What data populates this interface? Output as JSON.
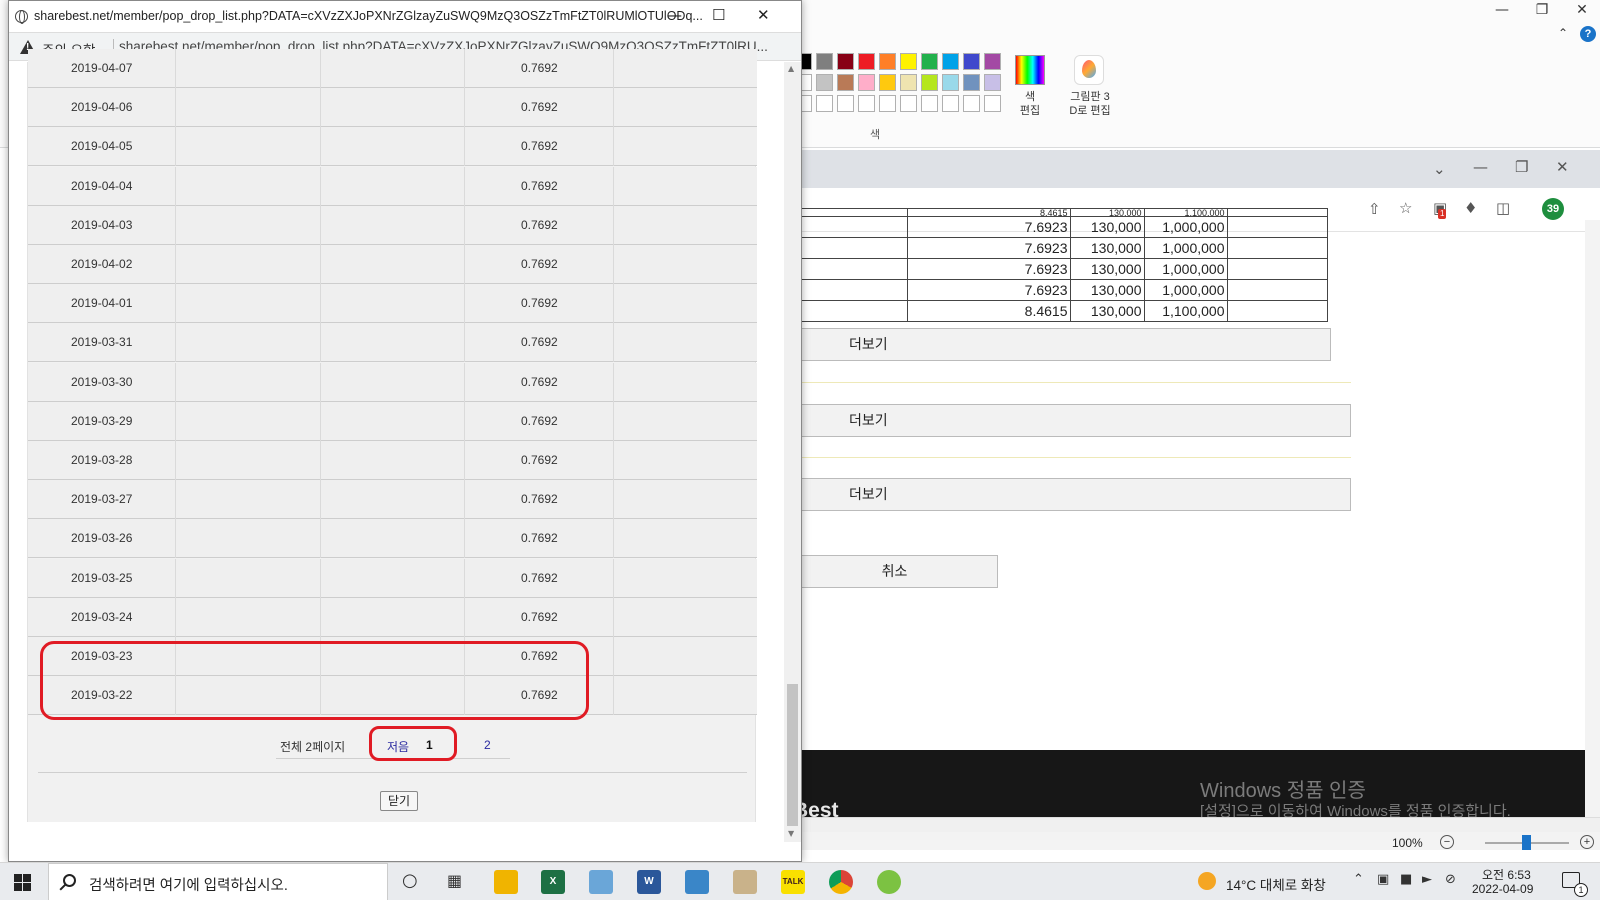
{
  "paint": {
    "palette_label": "색",
    "edit_colors_label": "색\n편집",
    "paint3d_label": "그림판 3\nD로 편집",
    "colors": [
      "#000000",
      "#7f7f7f",
      "#880015",
      "#ed1c24",
      "#ff7f27",
      "#fff200",
      "#22b14c",
      "#00a2e8",
      "#3f48cc",
      "#a349a4",
      "#ffffff",
      "#c3c3c3",
      "#b97a57",
      "#ffaec9",
      "#ffc90e",
      "#efe4b0",
      "#b5e61d",
      "#99d9ea",
      "#7092be",
      "#c8bfe7"
    ]
  },
  "browser": {
    "profile_count": "39",
    "extension_badge": "1",
    "table_rows": [
      [
        "8.4615",
        "130,000",
        "1,100,000"
      ],
      [
        "7.6923",
        "130,000",
        "1,000,000"
      ],
      [
        "7.6923",
        "130,000",
        "1,000,000"
      ],
      [
        "7.6923",
        "130,000",
        "1,000,000"
      ],
      [
        "7.6923",
        "130,000",
        "1,000,000"
      ],
      [
        "8.4615",
        "130,000",
        "1,100,000"
      ]
    ],
    "more_label": "더보기",
    "cancel_label": "취소",
    "footer_brand": "Best",
    "activation_title": "Windows 정품 인증",
    "activation_sub": "[설정]으로 이동하여 Windows를 정품 인증합니다.",
    "zoom": "100%"
  },
  "popup": {
    "title": "sharebest.net/member/pop_drop_list.php?DATA=cXVzZXJoPXNrZGlzayZuSWQ9MzQ3OSZzTmFtZT0lRUMlOTUlODq...",
    "warning_label": "주의 요함",
    "url": "sharebest.net/member/pop_drop_list.php?DATA=cXVzZXJoPXNrZGlzayZuSWQ9MzQ3OSZzTmFtZT0lRU...",
    "rows": [
      {
        "date": "2019-04-07",
        "value": "0.7692"
      },
      {
        "date": "2019-04-06",
        "value": "0.7692"
      },
      {
        "date": "2019-04-05",
        "value": "0.7692"
      },
      {
        "date": "2019-04-04",
        "value": "0.7692"
      },
      {
        "date": "2019-04-03",
        "value": "0.7692"
      },
      {
        "date": "2019-04-02",
        "value": "0.7692"
      },
      {
        "date": "2019-04-01",
        "value": "0.7692"
      },
      {
        "date": "2019-03-31",
        "value": "0.7692"
      },
      {
        "date": "2019-03-30",
        "value": "0.7692"
      },
      {
        "date": "2019-03-29",
        "value": "0.7692"
      },
      {
        "date": "2019-03-28",
        "value": "0.7692"
      },
      {
        "date": "2019-03-27",
        "value": "0.7692"
      },
      {
        "date": "2019-03-26",
        "value": "0.7692"
      },
      {
        "date": "2019-03-25",
        "value": "0.7692"
      },
      {
        "date": "2019-03-24",
        "value": "0.7692"
      },
      {
        "date": "2019-03-23",
        "value": "0.7692"
      },
      {
        "date": "2019-03-22",
        "value": "0.7692"
      }
    ],
    "pager": {
      "total_label": "전체 2페이지",
      "first_label": "저음",
      "current_page": "1",
      "next_page": "2"
    },
    "close_label": "닫기",
    "highlight_color": "#e01b24"
  },
  "taskbar": {
    "search_placeholder": "검색하려면 여기에 입력하십시오.",
    "weather": "14°C  대체로 화창",
    "time": "오전 6:53",
    "date": "2022-04-09",
    "notification_count": "1"
  }
}
